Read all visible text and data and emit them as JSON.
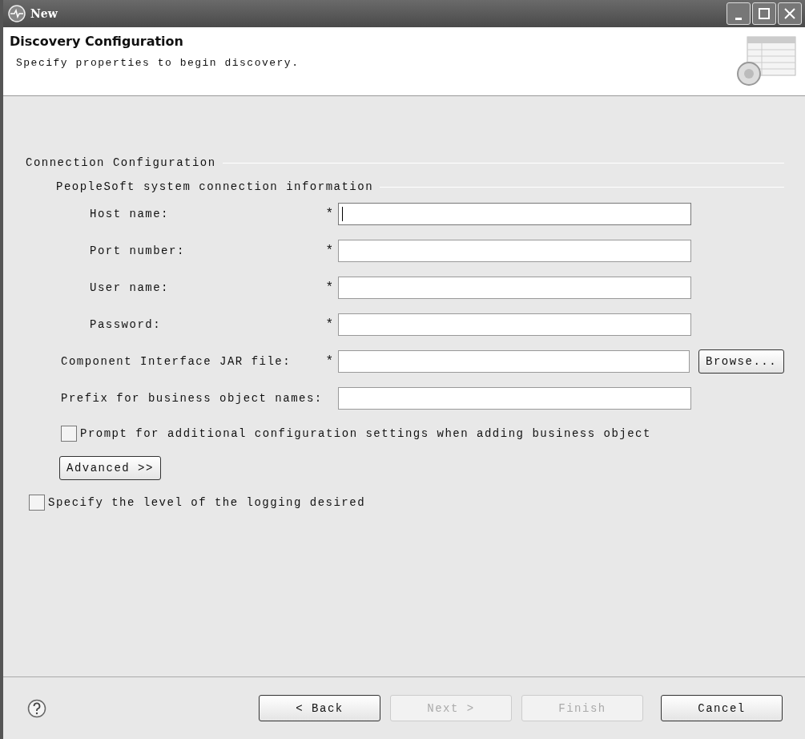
{
  "window": {
    "title": "New"
  },
  "header": {
    "title": "Discovery Configuration",
    "description": "Specify properties to begin discovery."
  },
  "connection": {
    "legend": "Connection Configuration",
    "system": {
      "legend": "PeopleSoft system connection information",
      "fields": [
        {
          "label": "Host name:",
          "marker": "*",
          "focused": true
        },
        {
          "label": "Port number:",
          "marker": "*",
          "focused": false
        },
        {
          "label": "User name:",
          "marker": "*",
          "focused": false
        },
        {
          "label": "Password:",
          "marker": "*",
          "focused": false
        }
      ]
    },
    "jar_field": {
      "label": "Component Interface JAR file:",
      "marker": "*",
      "button": "Browse..."
    },
    "prefix_field": {
      "label": "Prefix for business object names:"
    },
    "prompt_checkbox": {
      "label": "Prompt for additional configuration settings when adding business object",
      "checked": false
    },
    "advanced_button": "Advanced >>"
  },
  "logging_checkbox": {
    "label": "Specify the level of the logging desired",
    "checked": false
  },
  "footer": {
    "buttons": [
      {
        "label": "< Back",
        "disabled": false
      },
      {
        "label": "Next >",
        "disabled": true
      },
      {
        "label": "Finish",
        "disabled": true
      },
      {
        "label": "Cancel",
        "disabled": false
      }
    ]
  }
}
